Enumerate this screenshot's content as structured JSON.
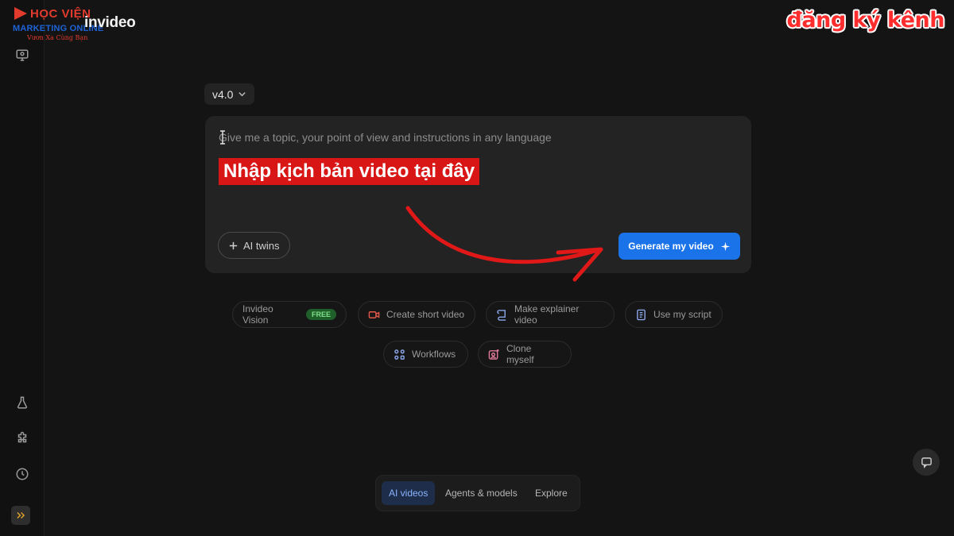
{
  "brand": {
    "hoc_text": "HỌC VIỆN",
    "marketing_text": "MARKETING ONLINE",
    "tagline": "Vươn Xa Cùng Bạn",
    "app_logo": "invideo",
    "accent_red": "#e23b2e",
    "accent_blue": "#1e63d6"
  },
  "channel_badge": "đăng ký kênh",
  "sidebar": {
    "icons": [
      "monitor-lightbulb-icon",
      "flask-icon",
      "puzzle-icon",
      "clock-icon"
    ],
    "expand_icon": "double-chevron-right-icon"
  },
  "version": {
    "label": "v4.0"
  },
  "prompt": {
    "placeholder": "Give me a topic, your point of view and instructions in any language",
    "overlay_label": "Nhập kịch bản video tại đây",
    "ai_twins_label": "AI twins",
    "generate_label": "Generate my video",
    "generate_color": "#1a73e8"
  },
  "chips": {
    "vision_label": "Invideo Vision",
    "vision_badge": "FREE",
    "short_video_label": "Create short video",
    "explainer_label": "Make explainer video",
    "script_label": "Use my script",
    "workflows_label": "Workflows",
    "clone_label": "Clone myself"
  },
  "bottom_tabs": {
    "ai_videos": "AI videos",
    "agents_models": "Agents & models",
    "explore": "Explore",
    "active": "AI videos"
  }
}
